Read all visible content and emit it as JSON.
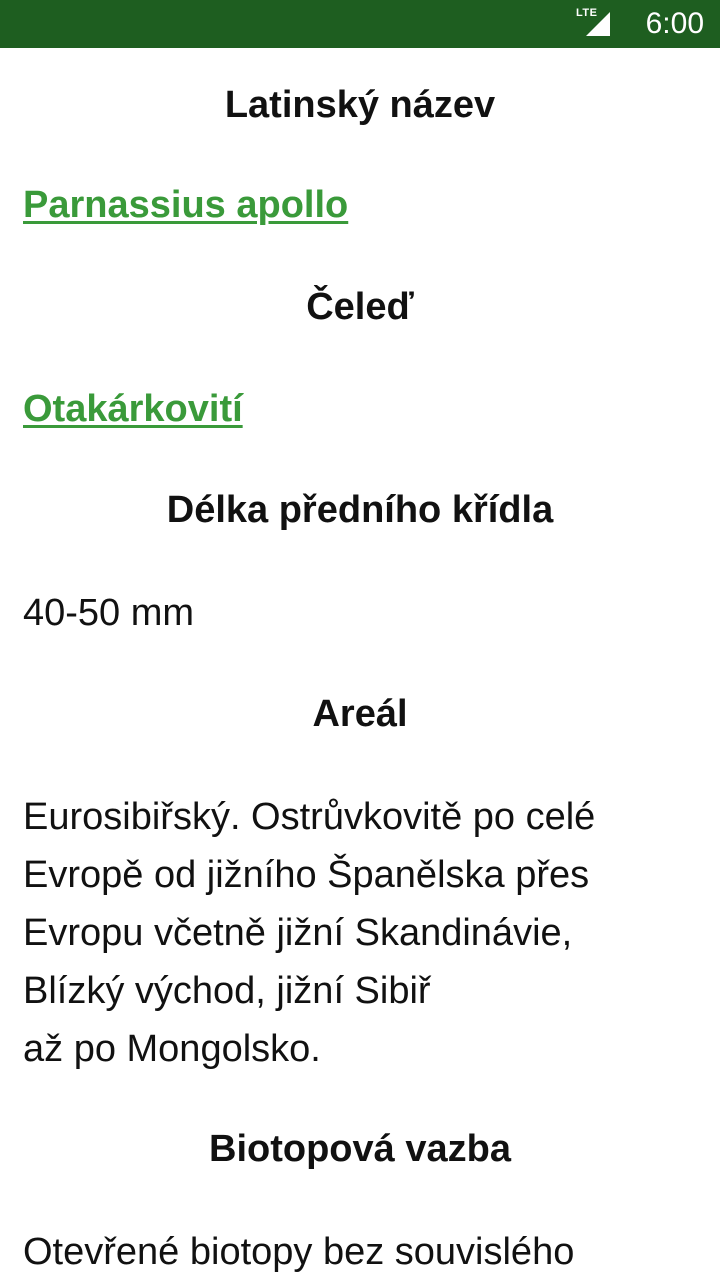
{
  "status_bar": {
    "network": "LTE",
    "time": "6:00"
  },
  "species": {
    "latin_heading": "Latinský název",
    "latin_name": "Parnassius apollo",
    "family_heading": "Čeleď",
    "family_name": "Otakárkovití",
    "wing_heading": "Délka předního křídla",
    "wing_value": "40-50 mm",
    "range_heading": "Areál",
    "range_lines": [
      "Eurosibiřský. Ostrůvkovitě po celé",
      "Evropě od jižního Španělska přes",
      "Evropu včetně jižní Skandinávie,",
      "Blízký východ, jižní Sibiř",
      "až po Mongolsko."
    ],
    "habitat_heading": "Biotopová vazba",
    "habitat_text": "Otevřené biotopy bez souvislého"
  },
  "colors": {
    "status_bar": "#1e5e20",
    "link": "#3a9a3a",
    "text": "#111111"
  }
}
